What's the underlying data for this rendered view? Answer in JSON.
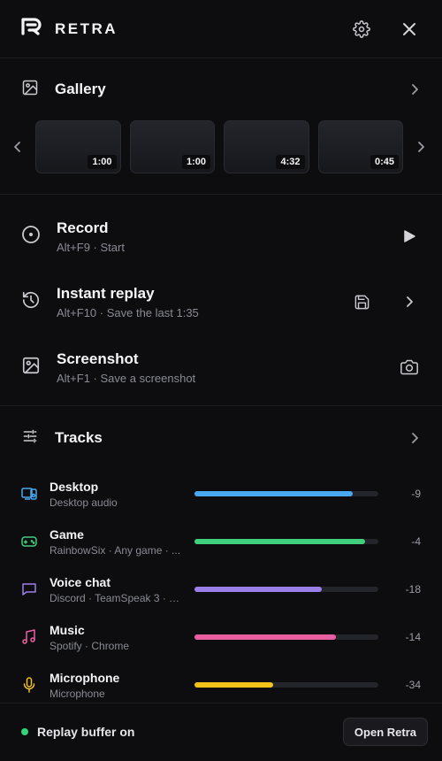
{
  "app": {
    "name": "RETRA"
  },
  "header": {
    "icons": [
      "logo-icon",
      "gear-icon",
      "close-icon"
    ]
  },
  "gallery": {
    "title": "Gallery",
    "clips": [
      {
        "duration": "1:00"
      },
      {
        "duration": "1:00"
      },
      {
        "duration": "4:32"
      },
      {
        "duration": "0:45"
      }
    ]
  },
  "actions": [
    {
      "title": "Record",
      "subtitle": "Alt+F9 · Start",
      "icon": "record-icon"
    },
    {
      "title": "Instant replay",
      "subtitle": "Alt+F10 · Save the last 1:35",
      "icon": "history-icon"
    },
    {
      "title": "Screenshot",
      "subtitle": "Alt+F1 · Save a screenshot",
      "icon": "image-icon"
    }
  ],
  "tracks": {
    "title": "Tracks",
    "items": [
      {
        "name": "Desktop",
        "subtitle": "Desktop audio",
        "value": "-9",
        "level": 0.86,
        "color": "#4aa9ee",
        "icon": "desktop-audio-icon"
      },
      {
        "name": "Game",
        "subtitle": "RainbowSix · Any game · ...",
        "value": "-4",
        "level": 0.93,
        "color": "#3fcf7e",
        "icon": "gamepad-icon"
      },
      {
        "name": "Voice chat",
        "subtitle": "Discord · TeamSpeak 3 · T...",
        "value": "-18",
        "level": 0.69,
        "color": "#9b7fe8",
        "icon": "chat-icon"
      },
      {
        "name": "Music",
        "subtitle": "Spotify · Chrome",
        "value": "-14",
        "level": 0.77,
        "color": "#ea5fa1",
        "icon": "music-icon"
      },
      {
        "name": "Microphone",
        "subtitle": "Microphone",
        "value": "-34",
        "level": 0.43,
        "color": "#f2c21b",
        "icon": "microphone-icon"
      }
    ]
  },
  "footer": {
    "status": "Replay buffer on",
    "open_label": "Open Retra",
    "status_color": "#33d17a"
  }
}
